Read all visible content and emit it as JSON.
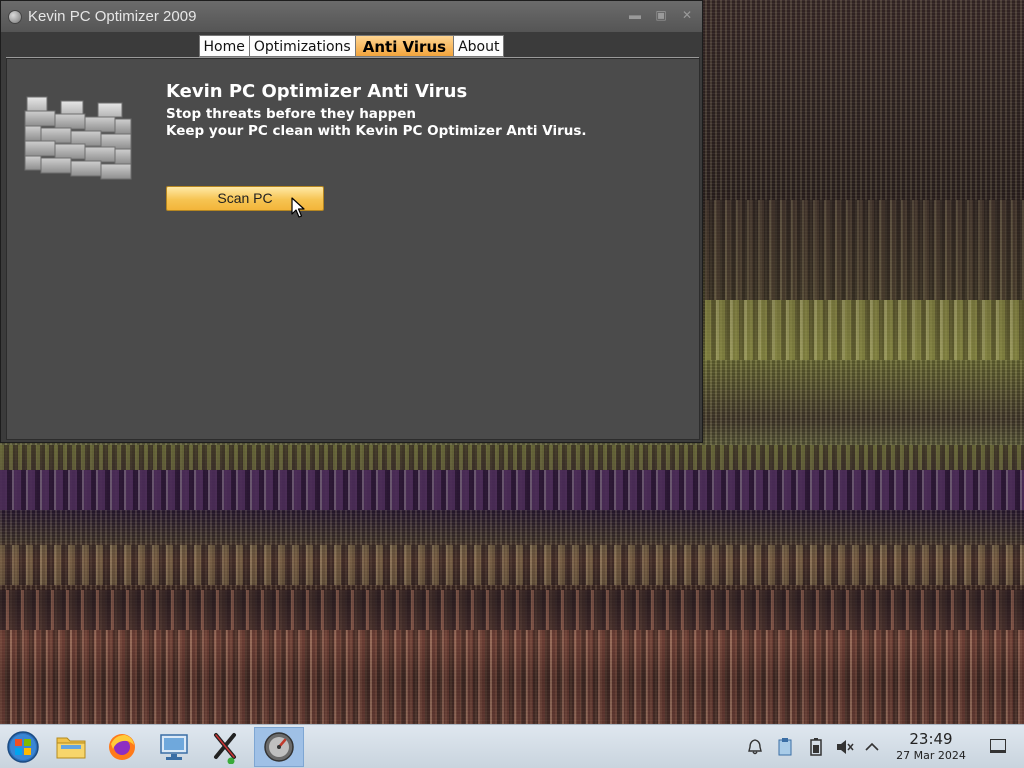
{
  "window": {
    "title": "Kevin PC Optimizer 2009",
    "controls": [
      "minimize",
      "maximize",
      "close"
    ]
  },
  "tabs": [
    {
      "label": "Home",
      "active": false
    },
    {
      "label": "Optimizations",
      "active": false
    },
    {
      "label": "Anti Virus",
      "active": true
    },
    {
      "label": "About",
      "active": false
    }
  ],
  "antivirus": {
    "heading": "Kevin PC Optimizer Anti Virus",
    "line1": "Stop threats before they happen",
    "line2": "Keep your PC clean with Kevin PC Optimizer Anti Virus.",
    "scan_button": "Scan PC",
    "icon": "firewall-wall-icon"
  },
  "taskbar": {
    "apps": [
      {
        "name": "start-menu",
        "icon": "windows-orb-icon"
      },
      {
        "name": "file-manager",
        "icon": "folder-icon"
      },
      {
        "name": "firefox",
        "icon": "firefox-icon"
      },
      {
        "name": "control-panel",
        "icon": "monitor-settings-icon"
      },
      {
        "name": "x-tool",
        "icon": "x-app-icon"
      },
      {
        "name": "optimizer",
        "icon": "gauge-icon",
        "active": true
      }
    ],
    "tray": [
      "notification-bell-icon",
      "clipboard-icon",
      "battery-icon",
      "volume-muted-icon",
      "chevron-up-icon"
    ],
    "time": "23:49",
    "date": "27 Mar 2024"
  },
  "colors": {
    "active_tab": "#f2a43c",
    "button": "#f6c452",
    "panel_bg": "#4b4b4b",
    "taskbar_bg": "#dfe7ef"
  }
}
